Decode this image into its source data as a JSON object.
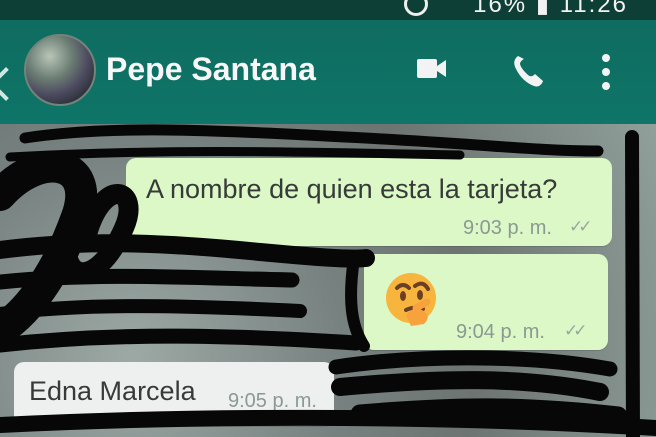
{
  "status_bar": {
    "battery_text": "16%",
    "time_text": "11:26"
  },
  "header": {
    "contact_name": "Pepe Santana",
    "actions": {
      "video_icon": "video-icon",
      "call_icon": "call-icon",
      "more_icon": "more-icon"
    }
  },
  "messages": [
    {
      "direction": "outgoing",
      "text": "A nombre de quien esta la tarjeta?",
      "time": "9:03 p. m.",
      "status": "✓✓"
    },
    {
      "direction": "outgoing",
      "text": "",
      "emoji_icon": "thinking-face-icon",
      "time": "9:04 p. m.",
      "status": "✓✓"
    },
    {
      "direction": "incoming",
      "text": "Edna Marcela",
      "time": "9:05 p. m."
    }
  ],
  "colors": {
    "header": "#0f6c60",
    "outgoing_bubble": "#dcf8c6",
    "incoming_bubble": "#eef0ef",
    "redaction": "#070707"
  }
}
